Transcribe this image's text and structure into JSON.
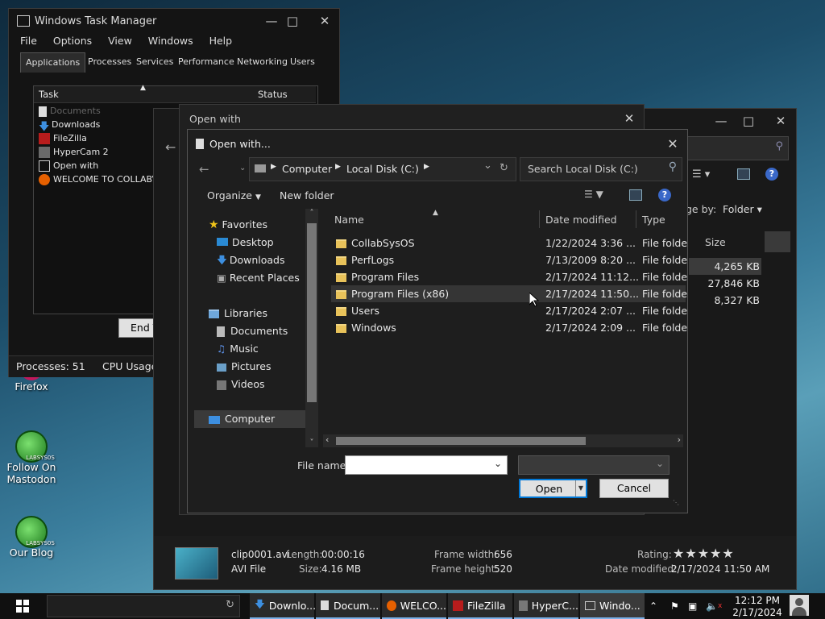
{
  "task_manager": {
    "title": "Windows Task Manager",
    "menu": [
      "File",
      "Options",
      "View",
      "Windows",
      "Help"
    ],
    "tabs": [
      "Applications",
      "Processes",
      "Services",
      "Performance",
      "Networking",
      "Users"
    ],
    "col_task": "Task",
    "col_status": "Status",
    "tasks": [
      "Documents",
      "Downloads",
      "FileZilla",
      "HyperCam 2",
      "Open with",
      "WELCOME TO COLLABVM"
    ],
    "end_task": "End T",
    "status_processes": "Processes: 51",
    "status_cpu": "CPU Usage"
  },
  "explorer_bg": {
    "size_header": "Size",
    "arrange_label": "ge by:",
    "arrange_value": "Folder",
    "sizes": [
      "4,265 KB",
      "27,846 KB",
      "8,327 KB"
    ],
    "details": {
      "filename": "clip0001.avi",
      "length_label": "Length:",
      "length": "00:00:16",
      "type": "AVI File",
      "size_label": "Size:",
      "size": "4.16 MB",
      "frame_width_label": "Frame width:",
      "frame_width": "656",
      "frame_height_label": "Frame height:",
      "frame_height": "520",
      "rating_label": "Rating:",
      "date_label": "Date modified:",
      "date": "2/17/2024 11:50 AM"
    }
  },
  "open_with": {
    "title": "Open with"
  },
  "dialog": {
    "title": "Open with...",
    "breadcrumb": [
      "Computer",
      "Local Disk (C:)"
    ],
    "search_placeholder": "Search Local Disk (C:)",
    "organize": "Organize",
    "new_folder": "New folder",
    "nav": {
      "favorites": "Favorites",
      "fav_items": [
        "Desktop",
        "Downloads",
        "Recent Places"
      ],
      "libraries": "Libraries",
      "lib_items": [
        "Documents",
        "Music",
        "Pictures",
        "Videos"
      ],
      "computer": "Computer"
    },
    "columns": {
      "name": "Name",
      "date": "Date modified",
      "type": "Type"
    },
    "files": [
      {
        "name": "CollabSysOS",
        "date": "1/22/2024 3:36 ...",
        "type": "File folde"
      },
      {
        "name": "PerfLogs",
        "date": "7/13/2009 8:20 ...",
        "type": "File folde"
      },
      {
        "name": "Program Files",
        "date": "2/17/2024 11:12...",
        "type": "File folde"
      },
      {
        "name": "Program Files (x86)",
        "date": "2/17/2024 11:50...",
        "type": "File folde"
      },
      {
        "name": "Users",
        "date": "2/17/2024 2:07 ...",
        "type": "File folde"
      },
      {
        "name": "Windows",
        "date": "2/17/2024 2:09 ...",
        "type": "File folde"
      }
    ],
    "file_name_label": "File name:",
    "file_name_value": "",
    "open_button": "Open",
    "cancel_button": "Cancel"
  },
  "desktop": {
    "icons": [
      "Firefox",
      "Follow On Mastodon",
      "Our Blog"
    ],
    "badge": "LABSYS0S"
  },
  "taskbar": {
    "items": [
      "Downlo...",
      "Docum...",
      "WELCO...",
      "FileZilla",
      "HyperC...",
      "Windo..."
    ],
    "time": "12:12 PM",
    "date": "2/17/2024"
  },
  "colors": {
    "accent": "#0078d7",
    "folder": "#e8c25a",
    "window": "#1b1b1b"
  }
}
